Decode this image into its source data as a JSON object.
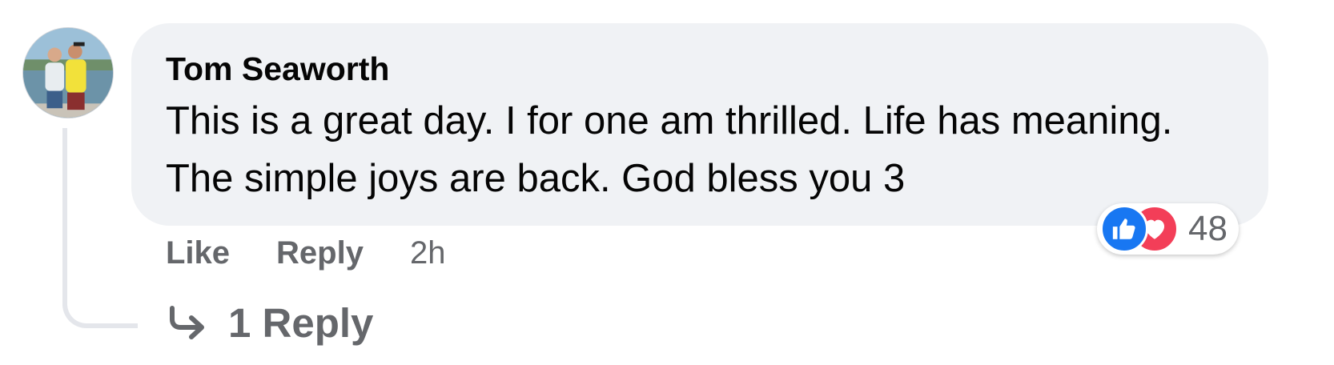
{
  "comment": {
    "author": "Tom Seaworth",
    "text": "This is a great day. I for one am thrilled. Life has meaning. The simple joys are back. God bless you 3"
  },
  "reactions": {
    "types": [
      "like",
      "love"
    ],
    "count": "48",
    "colors": {
      "like": "#1877f2",
      "love": "#f33e58"
    }
  },
  "actions": {
    "like_label": "Like",
    "reply_label": "Reply",
    "timestamp": "2h"
  },
  "replies": {
    "label": "1 Reply",
    "icon": "reply-arrow-icon"
  },
  "theme": {
    "bubble_bg": "#f0f2f5",
    "secondary_text": "#65676b",
    "primary_text": "#050505"
  }
}
